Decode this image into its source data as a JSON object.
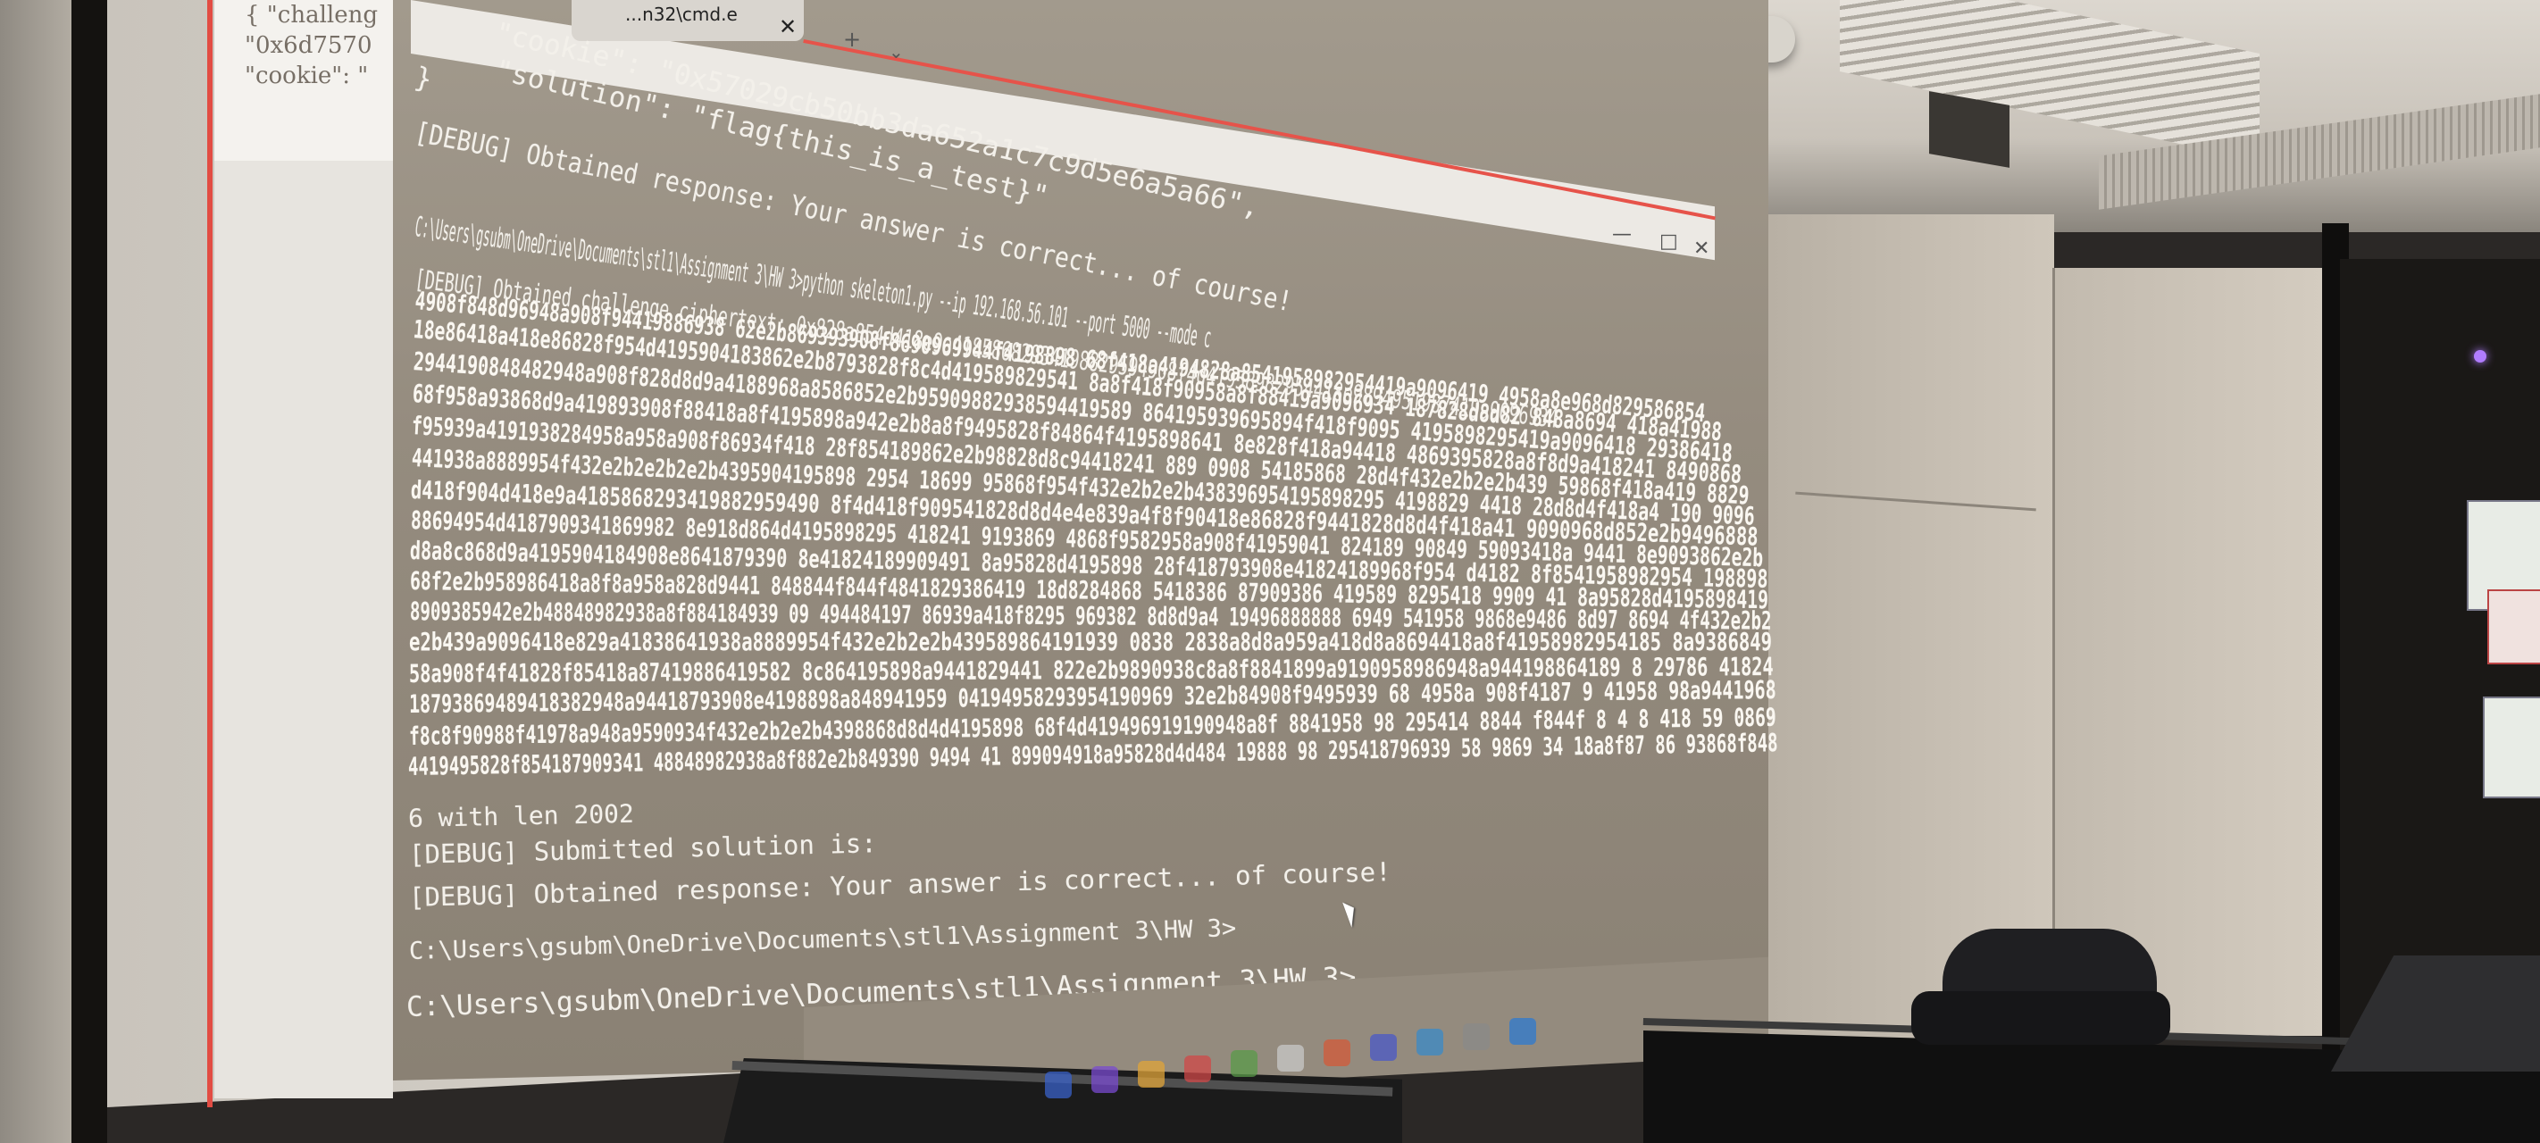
{
  "scene": "photo",
  "background_window": {
    "lines": [
      "{ \"challeng",
      "\"0x6d7570",
      "\"cookie\": \""
    ]
  },
  "terminal": {
    "tab_label": "...n32\\cmd.e",
    "lines": [
      "\"cookie\": \"0x57029cb50bb3da652a1c7c9d5e6a5a66\",",
      "\"solution\": \"flag{this_is_a_test}\"",
      "}",
      "[DEBUG] Obtained response: Your answer is correct... of course!",
      "C:\\Users\\gsubm\\OneDrive\\Documents\\stl1\\Assignment 3\\HW 3>python skeleton1.py --ip 192.168.56.101 --port 5000 --mode c",
      "[DEBUG] Obtained challenge ciphertext: 0x828a854d418e9a41858682934198829594908f4d41958982954418e9894951987419a9096934",
      "4908f848d96948a908f94419886938 62e2b869393908f8690969944f4198898 68f418a4194828a8541958982954419a9096419 4958a8e968d829586854",
      "18e86418a418e86828f954d4195904183862e2b8793828f8c4d419589829541 8a8f418f90958a8f88419a9096934 187828d8d82 848a8694 418a41988",
      "2944190848482948a908f828d8d9a4188968a8586852e2b95909882938594419589 864195939695894f418f9095 4195898295419a9096418 29386418",
      "68f958a93868d9a419893908f88418a8f4195898a942e2b8a8f9495828f84864f4195898641 8e828f418a94418 4869395828a8f8d9a418241 8490868",
      "f95939a4191938284958a958a908f86934f418 28f854189862e2b98828d8c94418241 889 0908 54185868 28d4f432e2b2e2b439 59868f418a419 8829",
      "441938a8889954f432e2b2e2b2e2b4395904195898 2954 18699 95868f954f432e2b2e2b438396954195898295 4198829 4418 28d8d4f418a4 190 9096",
      "d418f904d418e9a4185868293419882959490 8f4d418f909541828d8d4e4e839a4f8f90418e86828f9441828d8d4f418a41 9090968d852e2b9496888",
      "88694954d4187909341869982 8e918d864d4195898295 418241 9193869 4868f9582958a908f41959041 824189 90849 59093418a 9441 8e9093862e2b",
      "d8a8c868d9a4195904184908e8641879390 8e41824189909491 8a95828d4195898 28f418793908e41824189968f954 d4182 8f8541958982954 198898",
      "68f2e2b958986418a8f8a958a828d9441 848844f844f4841829386419 18d8284868 5418386 87909386 419589 8295418 9909 41 8a95828d4195898419",
      "8909385942e2b48848982938a8f884184939 09 494484197 86939a418f8295 969382 8d8d9a4 19496888888 6949 541958 9868e9486 8d97 8694 4f432e2b2",
      "e2b439a9096418e829a41838641938a8889954f432e2b2e2b439589864191939 0838 2838a8d8a959a418d8a8694418a8f41958982954185 8a9386849",
      "58a908f4f41828f85418a87419886419582 8c864195898a9441829441 822e2b9890938c8a8f8841899a9190958986948a944198864189 8 29786 41824",
      "18793869489418382948a94418793908e4198898a848941959 04194958293954190969 32e2b84908f9495939 68 4958a 908f4187 9 41958 98a9441968",
      "f8c8f90988f41978a948a9590934f432e2b2e2b4398868d8d4d4195898 68f4d419496919190948a8f 8841958 98 295414 8844 f844f 8 4 8 418 59 0869",
      "4419495828f854187909341 48848982938a8f882e2b849390 9494 41 899094918a95828d4d484 19888 98 295418796939 58 9869 34 18a8f87 86 93868f848",
      "6 with len 2002",
      "[DEBUG] Submitted solution is:",
      "[DEBUG] Obtained response: Your answer is correct... of course!",
      "C:\\Users\\gsubm\\OneDrive\\Documents\\stl1\\Assignment 3\\HW 3>",
      "C:\\Users\\gsubm\\OneDrive\\Documents\\stl1\\Assignment 3\\HW 3>"
    ]
  },
  "colors": {
    "terminal_bg": "#958c7f",
    "terminal_text": "#f3f0ea",
    "accent_red": "#e6534a",
    "screen_edge_blue": "#2b2d63"
  },
  "taskbar": {
    "icons": [
      "search-icon",
      "chat-icon",
      "folder-icon",
      "app-icon",
      "document-icon",
      "app-icon",
      "app-icon",
      "app-icon",
      "app-icon",
      "app-icon",
      "app-icon"
    ]
  }
}
